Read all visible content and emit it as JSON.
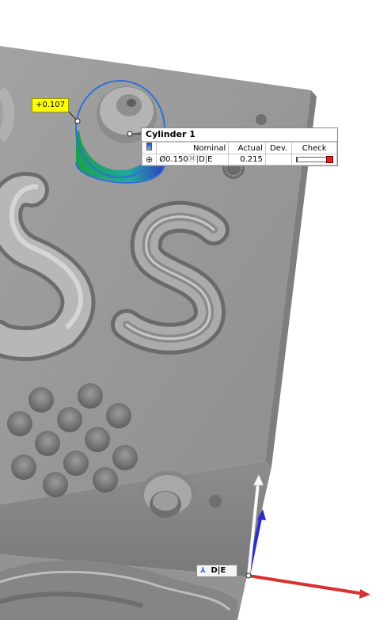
{
  "deviation_label": {
    "value": "+0.107",
    "color": "#ffff00"
  },
  "inspection": {
    "title": "Cylinder 1",
    "columns": {
      "nominal": "Nominal",
      "actual": "Actual",
      "deviation": "Dev.",
      "check": "Check"
    },
    "row": {
      "nominal_value": "Ø0.150",
      "modifier": "Ⓜ",
      "datum_1": "D",
      "datum_2": "E",
      "actual": "0.215",
      "deviation": "",
      "check_level": 1.0,
      "check_color": "#e02020"
    },
    "icons": {
      "scale": "scale-icon",
      "position": "position-tolerance-icon"
    }
  },
  "coordinate_system": {
    "label": "D|E",
    "icon": "coordinate-system-icon",
    "axis_colors": {
      "x": "#d93030",
      "y": "#ffffff",
      "z": "#2b2bd0"
    }
  },
  "colors": {
    "part": "#9a9a9a",
    "deviation_positive": "#20b040",
    "highlight": "#2f6fd6"
  }
}
